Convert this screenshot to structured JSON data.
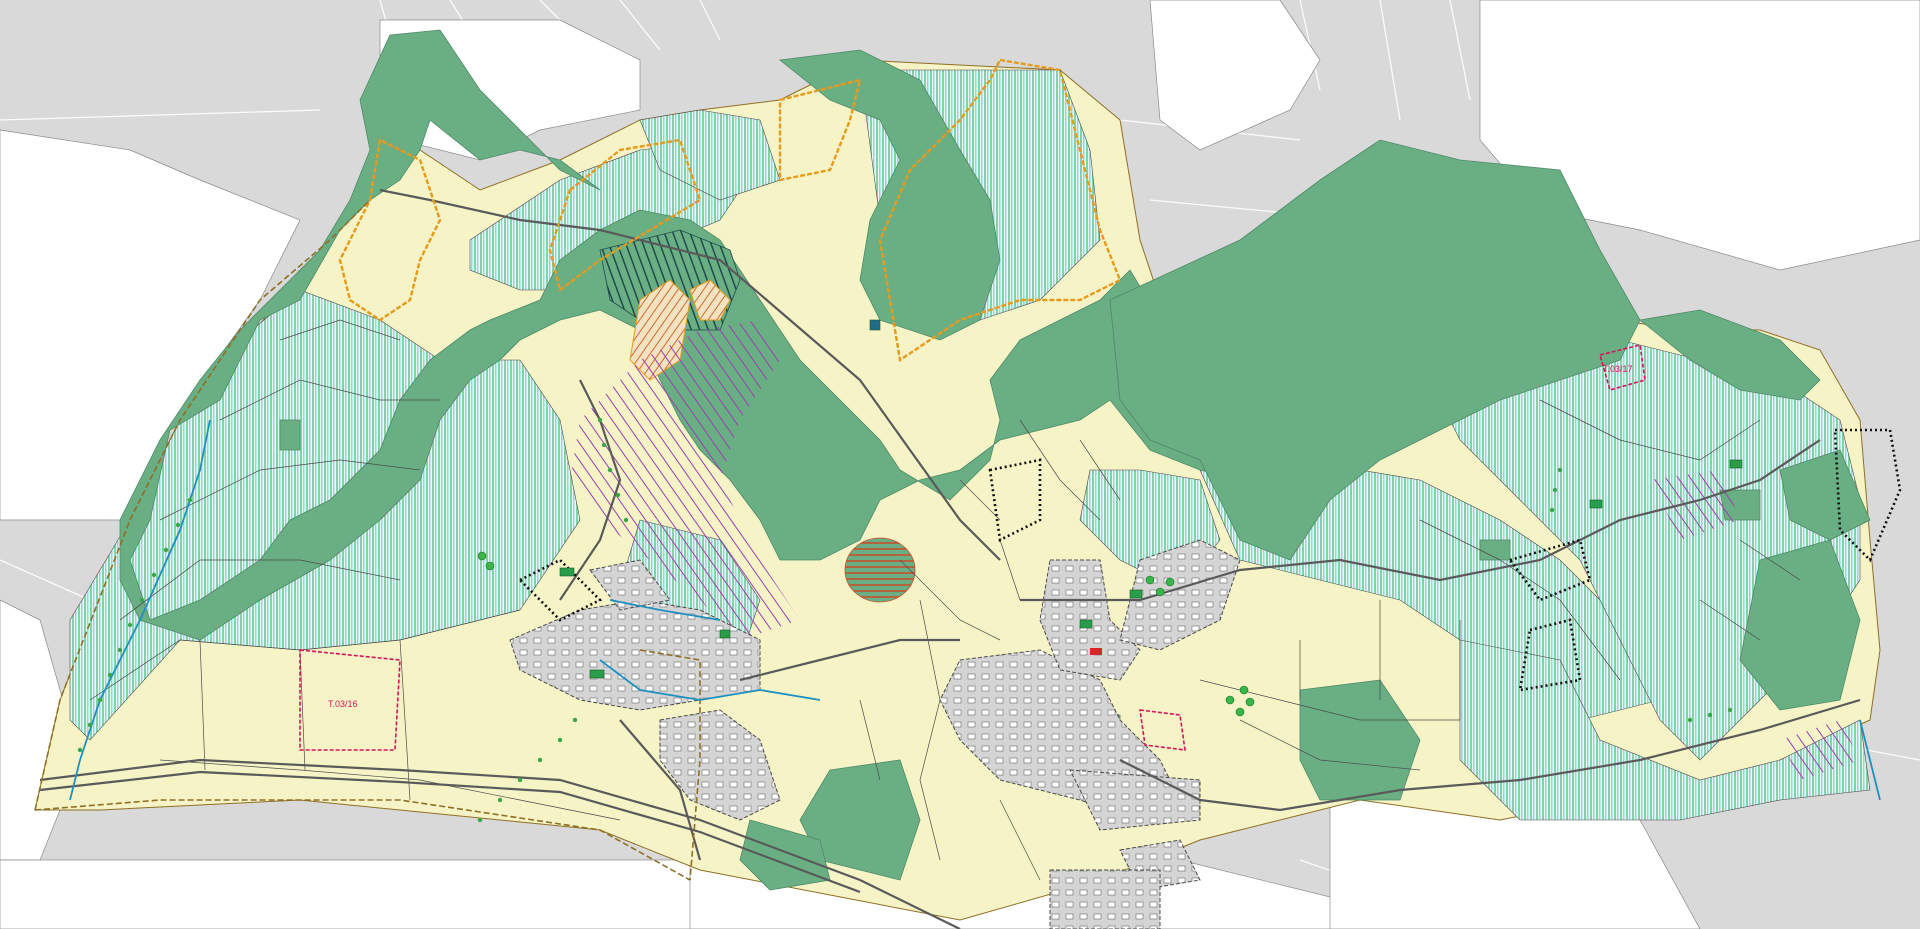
{
  "map": {
    "labels": [
      {
        "id": "parcel-label-west",
        "text": "T.03/16"
      },
      {
        "id": "parcel-label-east",
        "text": "T.03/17"
      }
    ],
    "colors": {
      "background_map": "#d9d9d9",
      "cadastral_lines": "#ffffff",
      "forest": "#6aae84",
      "agriculture_hatch_green": "#7fd3a4",
      "agriculture_hatch_blue": "#8fc4e0",
      "agricultural_base": "#f6f3c6",
      "settlement": "#cfcfcf",
      "parcel_lines": "#4b4b4b",
      "landscape_boundary_orange": "#e79b1a",
      "plan_boundary": "#8f6f24",
      "designation_magenta": "#d4145a",
      "purple_hatch": "#9a3fb3",
      "watercourse": "#1e90c0",
      "hedge_dots": "#3aa64a"
    },
    "icons": [
      "tree-icon"
    ]
  }
}
